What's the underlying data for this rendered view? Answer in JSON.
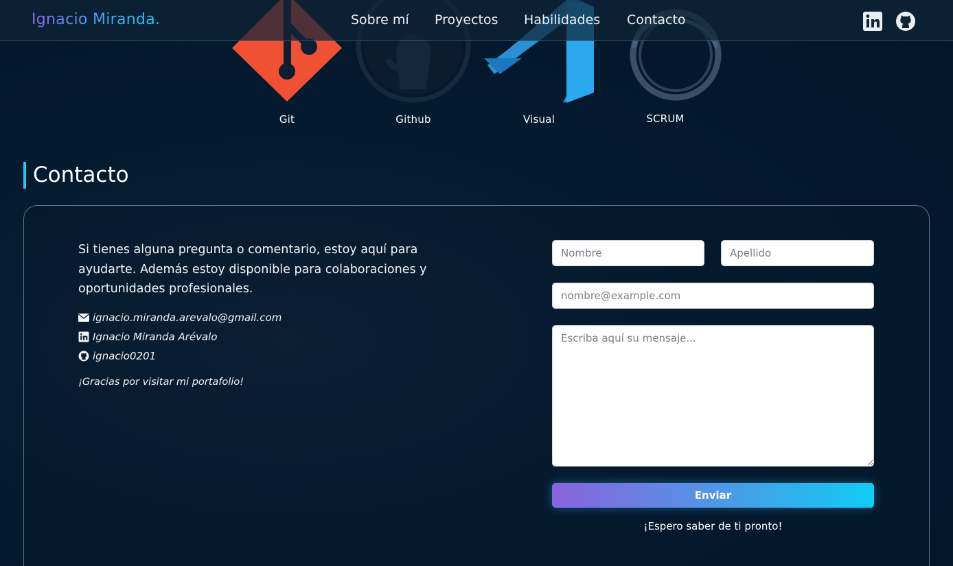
{
  "brand": "Ignacio Miranda.",
  "nav": {
    "links": [
      "Sobre mí",
      "Proyectos",
      "Habilidades",
      "Contacto"
    ],
    "social_icons": [
      "linkedin-icon",
      "github-icon"
    ]
  },
  "skills": [
    {
      "label": "Git",
      "icon": "git-logo"
    },
    {
      "label": "Github",
      "icon": "github-logo"
    },
    {
      "label": "Visual",
      "icon": "vscode-logo"
    },
    {
      "label": "SCRUM",
      "icon": "scrum-logo"
    }
  ],
  "contact": {
    "title": "Contacto",
    "intro": "Si tienes alguna pregunta o comentario, estoy aquí para ayudarte. Además estoy disponible para colaboraciones y oportunidades profesionales.",
    "email": "ignacio.miranda.arevalo@gmail.com",
    "linkedin": "Ignacio Miranda Arévalo",
    "github": "ignacio0201",
    "thanks": "¡Gracias por visitar mi portafolio!"
  },
  "form": {
    "first_name_placeholder": "Nombre",
    "last_name_placeholder": "Apellido",
    "email_placeholder": "nombre@example.com",
    "message_placeholder": "Escriba aquí su mensaje...",
    "submit_label": "Enviar",
    "footer_note": "¡Espero saber de ti pronto!"
  },
  "colors": {
    "accent": "#1ec8f5",
    "brand_gradient_start": "#8b6be8",
    "background": "#03182c",
    "git": "#f05133",
    "vscode": "#23a9f2"
  }
}
